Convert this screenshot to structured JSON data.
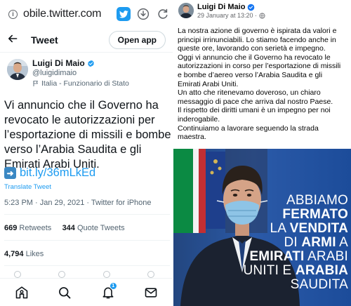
{
  "browser": {
    "url": "obile.twitter.com",
    "icons": [
      "info-icon",
      "twitter-icon",
      "download-icon",
      "refresh-icon"
    ]
  },
  "twitter": {
    "header": {
      "title": "Tweet",
      "open_app": "Open app"
    },
    "author": {
      "name": "Luigi Di Maio",
      "handle": "@luigidimaio",
      "label": "Italia - Funzionario di Stato"
    },
    "tweet": {
      "text": "Vi annuncio che il Governo ha revocato le autorizzazioni per l’esportazione di missili e bombe verso l’Arabia Saudita e gli Emirati Arabi Uniti.",
      "link": "bit.ly/36mLkEd",
      "translate": "Translate Tweet",
      "meta": "5:23 PM · Jan 29, 2021 · Twitter for iPhone"
    },
    "stats": {
      "retweets_count": "669",
      "retweets_label": "Retweets",
      "quotes_count": "344",
      "quotes_label": "Quote Tweets",
      "likes_count": "4,794",
      "likes_label": "Likes"
    },
    "nav": {
      "notifications_badge": "1",
      "items": [
        "home-icon",
        "search-icon",
        "notifications-icon",
        "messages-icon"
      ]
    },
    "colors": {
      "accent": "#1d9bf0",
      "text": "#0f1419",
      "muted": "#536471"
    }
  },
  "facebook": {
    "name": "Luigi Di Maio",
    "date": "29 January at 13:20 ·",
    "paragraphs": [
      "La nostra azione di governo è ispirata da valori e principi irrinunciabili. Lo stiamo facendo anche in queste ore, lavorando con serietà e impegno.",
      "Oggi vi annuncio che il Governo ha revocato le autorizzazioni in corso per l’esportazione di missili e bombe d’aereo verso l’Arabia Saudita e gli Emirati Arabi Uniti.",
      "Un atto che ritenevamo doveroso, un chiaro messaggio di pace che arriva dal nostro Paese.",
      "Il rispetto dei diritti umani è un impegno per noi inderogabile.",
      "Continuiamo a lavorare seguendo la strada maestra."
    ],
    "image_slogan": {
      "l1": "ABBIAMO",
      "l2": "FERMATO",
      "l3a": "LA ",
      "l3b": "VENDITA",
      "l4a": "DI ",
      "l4b": "ARMI",
      "l4c": " A",
      "l5a": "EMIRATI",
      "l5b": " ARABI",
      "l6a": "UNITI E ",
      "l6b": "ARABIA",
      "l7": "SAUDITA"
    },
    "colors": {
      "slogan_bg": "#1d4f9c"
    }
  }
}
